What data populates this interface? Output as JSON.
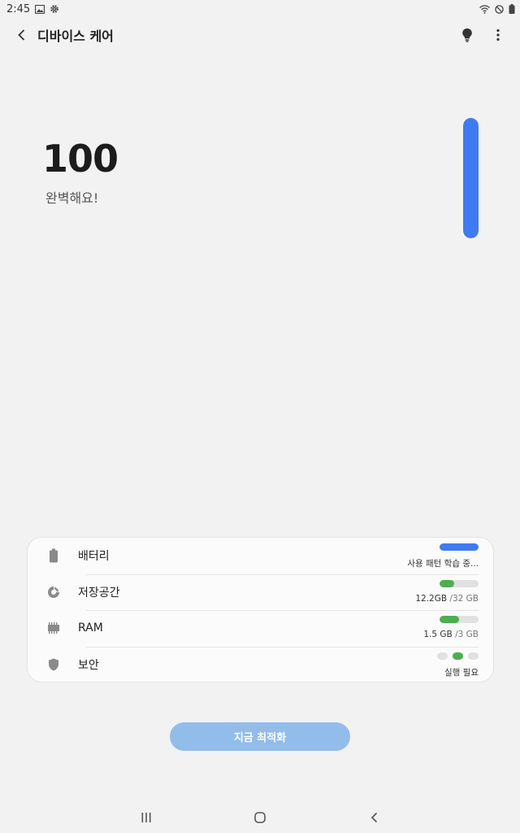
{
  "status_bar": {
    "time": "2:45"
  },
  "app_bar": {
    "title": "디바이스 케어"
  },
  "score": {
    "value": "100",
    "message": "완벽해요!",
    "level": 100
  },
  "colors": {
    "accent": "#3f7af2",
    "good": "#4caf50",
    "track": "#e1e1e1",
    "button": "#92bcea"
  },
  "items": [
    {
      "label": "배터리",
      "icon": "battery-icon",
      "status": "사용 패턴 학습 중...",
      "status_muted": "",
      "fill_percent": 100,
      "fill_color": "#3f7af2"
    },
    {
      "label": "저장공간",
      "icon": "storage-pie-icon",
      "status": "12.2GB",
      "status_muted": " /32 GB",
      "fill_percent": 38,
      "fill_color": "#4caf50"
    },
    {
      "label": "RAM",
      "icon": "memory-chip-icon",
      "status": "1.5 GB",
      "status_muted": " /3 GB",
      "fill_percent": 50,
      "fill_color": "#4caf50"
    },
    {
      "label": "보안",
      "icon": "shield-icon",
      "status": "실행 필요",
      "status_muted": "",
      "dots_active": 1
    }
  ],
  "optimize_button": {
    "label": "지금 최적화"
  }
}
